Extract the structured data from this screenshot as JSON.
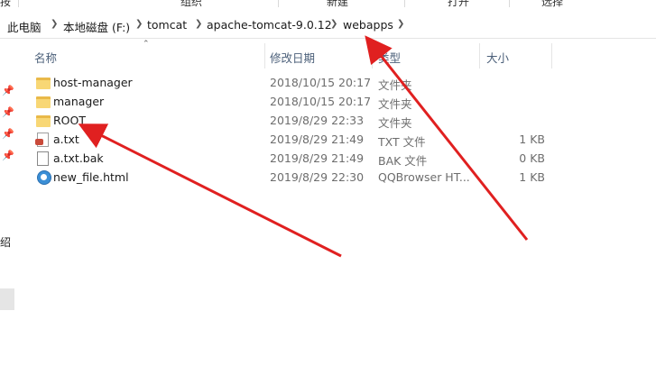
{
  "ribbon": {
    "items": [
      "按",
      "组织",
      "新建",
      "打开",
      "选择"
    ]
  },
  "address": {
    "crumbs": [
      "此电脑",
      "本地磁盘 (F:)",
      "tomcat",
      "apache-tomcat-9.0.12",
      "webapps"
    ]
  },
  "nav": {
    "partial_text": "绍"
  },
  "columns": {
    "name": "名称",
    "date": "修改日期",
    "type": "类型",
    "size": "大小"
  },
  "files": [
    {
      "name": "host-manager",
      "date": "2018/10/15 20:17",
      "type": "文件夹",
      "size": "",
      "icon": "folder-icon"
    },
    {
      "name": "manager",
      "date": "2018/10/15 20:17",
      "type": "文件夹",
      "size": "",
      "icon": "folder-icon"
    },
    {
      "name": "ROOT",
      "date": "2019/8/29 22:33",
      "type": "文件夹",
      "size": "",
      "icon": "folder-icon"
    },
    {
      "name": "a.txt",
      "date": "2019/8/29 21:49",
      "type": "TXT 文件",
      "size": "1 KB",
      "icon": "text-file-icon"
    },
    {
      "name": "a.txt.bak",
      "date": "2019/8/29 21:49",
      "type": "BAK 文件",
      "size": "0 KB",
      "icon": "blank-file-icon"
    },
    {
      "name": "new_file.html",
      "date": "2019/8/29 22:30",
      "type": "QQBrowser HT...",
      "size": "1 KB",
      "icon": "browser-file-icon"
    }
  ],
  "colors": {
    "annotation_arrow": "#e02020",
    "folder": "#f8d775",
    "header_text": "#4c607a"
  }
}
